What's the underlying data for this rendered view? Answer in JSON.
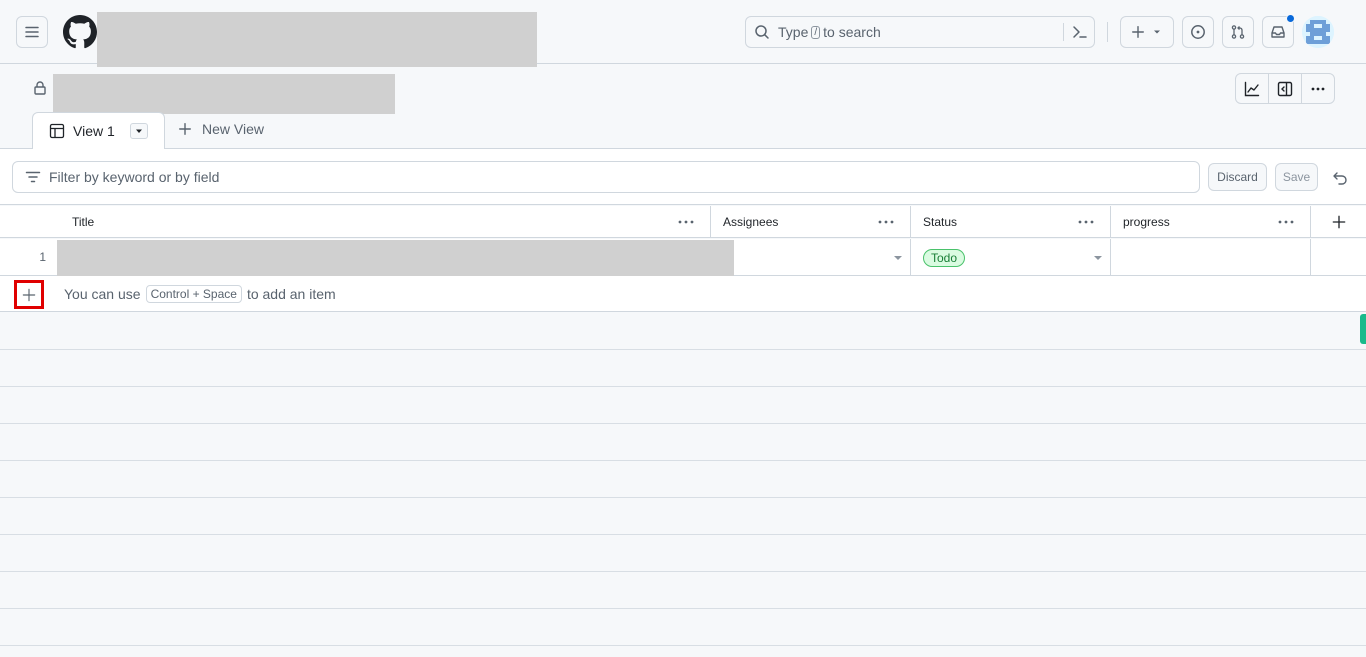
{
  "header": {
    "search_prefix": "Type",
    "search_key": "/",
    "search_suffix": "to search"
  },
  "tabs": [
    {
      "label": "View 1",
      "active": true
    },
    {
      "label": "New View",
      "active": false
    }
  ],
  "filter": {
    "placeholder": "Filter by keyword or by field",
    "discard_label": "Discard",
    "save_label": "Save"
  },
  "table": {
    "columns": [
      "Title",
      "Assignees",
      "Status",
      "progress"
    ],
    "rows": [
      {
        "number": "1",
        "title": "",
        "assignees": "",
        "status": "Todo",
        "progress": ""
      }
    ],
    "add_hint_prefix": "You can use",
    "add_hint_key": "Control + Space",
    "add_hint_suffix": "to add an item"
  },
  "colors": {
    "accent": "#0969da",
    "status_todo_bg": "#dafbe1",
    "status_todo_text": "#1a7f37",
    "highlight_box": "#e00000"
  }
}
